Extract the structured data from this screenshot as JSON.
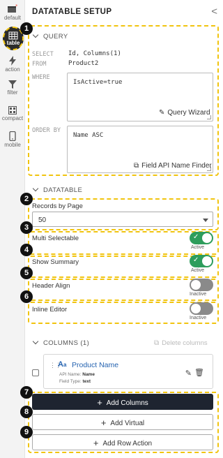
{
  "rail": {
    "items": [
      {
        "label": "default",
        "icon": "default-icon"
      },
      {
        "label": "table",
        "icon": "table-icon"
      },
      {
        "label": "action",
        "icon": "lightning-icon"
      },
      {
        "label": "filter",
        "icon": "filter-icon"
      },
      {
        "label": "compact",
        "icon": "compact-icon"
      },
      {
        "label": "mobile",
        "icon": "mobile-icon"
      }
    ]
  },
  "header": {
    "title": "DATATABLE SETUP",
    "collapse_icon": "<"
  },
  "badges": [
    "1",
    "2",
    "3",
    "4",
    "5",
    "6",
    "7",
    "8",
    "9"
  ],
  "query": {
    "heading": "QUERY",
    "select_label": "SELECT",
    "select_value": "Id, Columns(1)",
    "from_label": "FROM",
    "from_value": "Product2",
    "where_label": "WHERE",
    "where_value": "IsActive=true",
    "query_wizard": "Query Wizard",
    "orderby_label": "ORDER BY",
    "orderby_value": "Name ASC",
    "field_api_finder": "Field API Name Finder"
  },
  "datatable": {
    "heading": "DATATABLE",
    "records_label": "Records by Page",
    "records_value": "50",
    "multi_selectable_label": "Multi Selectable",
    "multi_selectable_status": "Active",
    "show_summary_label": "Show Summary",
    "show_summary_status": "Active",
    "header_align_label": "Header Align",
    "header_align_status": "Inactive",
    "inline_editor_label": "Inline Editor",
    "inline_editor_status": "Inactive"
  },
  "columns": {
    "heading": "COLUMNS (1)",
    "delete_label": "Delete columns",
    "item": {
      "name": "Product Name",
      "api_name_label": "API Name:",
      "api_name_value": "Name",
      "field_type_label": "Field Type:",
      "field_type_value": "text"
    },
    "add_columns": "Add Columns",
    "add_virtual": "Add Virtual",
    "add_row_action": "Add Row Action"
  },
  "colors": {
    "accent": "#f1c40f",
    "toggle_on": "#2e9d5c",
    "toggle_off": "#8a8a8a",
    "primary_button": "#1e2430"
  }
}
